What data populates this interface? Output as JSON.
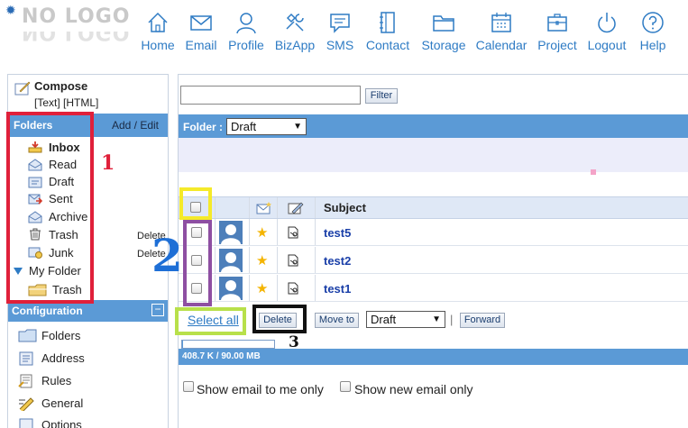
{
  "logo": {
    "text": "NO LOGO"
  },
  "nav": [
    {
      "label": "Home",
      "icon": "home-icon"
    },
    {
      "label": "Email",
      "icon": "email-icon"
    },
    {
      "label": "Profile",
      "icon": "profile-icon"
    },
    {
      "label": "BizApp",
      "icon": "bizapp-icon"
    },
    {
      "label": "SMS",
      "icon": "sms-icon"
    },
    {
      "label": "Contact",
      "icon": "contact-icon"
    },
    {
      "label": "Storage",
      "icon": "storage-icon"
    },
    {
      "label": "Calendar",
      "icon": "calendar-icon"
    },
    {
      "label": "Project",
      "icon": "project-icon"
    },
    {
      "label": "Logout",
      "icon": "logout-icon"
    },
    {
      "label": "Help",
      "icon": "help-icon"
    }
  ],
  "sidebar": {
    "compose": "Compose",
    "modes": "[Text] [HTML]",
    "folders_title": "Folders",
    "add_edit": "Add / Edit",
    "folders": [
      {
        "label": "Inbox",
        "icon": "inbox-icon"
      },
      {
        "label": "Read",
        "icon": "read-icon"
      },
      {
        "label": "Draft",
        "icon": "draft-icon"
      },
      {
        "label": "Sent",
        "icon": "sent-icon"
      },
      {
        "label": "Archive",
        "icon": "archive-icon"
      },
      {
        "label": "Trash",
        "icon": "trash-icon"
      },
      {
        "label": "Junk",
        "icon": "junk-icon"
      }
    ],
    "delete_label": "Delete",
    "my_folder": "My Folder",
    "my_folder_items": [
      {
        "label": "Trash",
        "icon": "folder-icon"
      }
    ],
    "config_title": "Configuration",
    "config_items": [
      {
        "label": "Folders",
        "icon": "folders-config-icon"
      },
      {
        "label": "Address",
        "icon": "address-icon"
      },
      {
        "label": "Rules",
        "icon": "rules-icon"
      },
      {
        "label": "General",
        "icon": "general-icon"
      },
      {
        "label": "Options",
        "icon": "options-icon"
      }
    ]
  },
  "main": {
    "filter_label": "Filter",
    "folder_label": "Folder :",
    "folder_value": "Draft",
    "subject_header": "Subject",
    "emails": [
      {
        "subject": "test5"
      },
      {
        "subject": "test2"
      },
      {
        "subject": "test1"
      }
    ],
    "select_all": "Select all",
    "delete_label": "Delete",
    "move_to_label": "Move to",
    "move_to_value": "Draft",
    "separator": "|",
    "forward_label": "Forward",
    "quota_text": "408.7 K / 90.00 MB",
    "quota_fraction": 0.0044,
    "show_to_me": "Show email to me only",
    "show_new": "Show new email only"
  },
  "annotations": {
    "n1": "1",
    "n2": "2",
    "n3": "3"
  },
  "colors": {
    "header_blue": "#5b9ad6",
    "nav_blue": "#2e7bc4",
    "red": "#e0203a",
    "yellow": "#f5ea2a",
    "purple": "#8e4fa2",
    "green": "#b8e04a"
  }
}
